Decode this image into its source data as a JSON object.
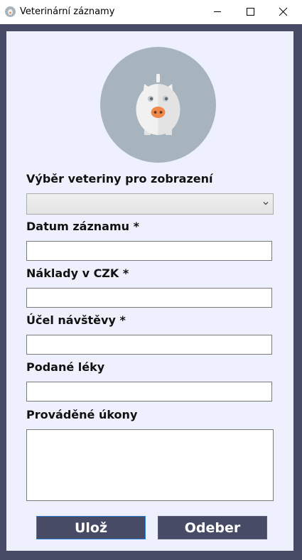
{
  "window": {
    "title": "Veterinární záznamy",
    "app_icon": "app-icon"
  },
  "title_controls": {
    "minimize_icon": "minimize-icon",
    "maximize_icon": "maximize-icon",
    "close_icon": "close-icon"
  },
  "logo": {
    "icon": "piggy-bank-icon"
  },
  "form": {
    "vet_select_label": "Výběr veteriny pro zobrazení",
    "vet_select_value": "",
    "date_label": "Datum záznamu *",
    "date_value": "",
    "cost_label": "Náklady v CZK *",
    "cost_value": "",
    "purpose_label": "Účel návštěvy *",
    "purpose_value": "",
    "meds_label": "Podané léky",
    "meds_value": "",
    "procedures_label": "Prováděné úkony",
    "procedures_value": ""
  },
  "buttons": {
    "save_label": "Ulož",
    "remove_label": "Odeber"
  },
  "colors": {
    "frame": "#474b66",
    "content_bg": "#eef0fd",
    "logo_circle": "#a8b4bd",
    "pig_body": "#f1f1f1",
    "pig_snout": "#f0884a",
    "button_bg": "#474b66",
    "button_focus_border": "#2b7fd0"
  }
}
